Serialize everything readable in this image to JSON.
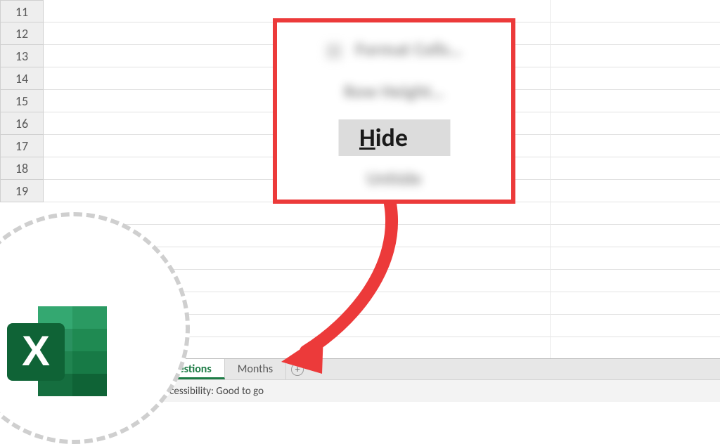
{
  "row_headers": [
    "11",
    "12",
    "13",
    "14",
    "15",
    "16",
    "17",
    "18",
    "19"
  ],
  "context_menu": {
    "item_format": "Format Cells…",
    "item_row_height": "Row Height…",
    "item_hide_pre": "H",
    "item_hide_post": "ide",
    "item_unhide": "Unhide"
  },
  "tabs": {
    "active": "Questions",
    "second": "Months"
  },
  "status": {
    "accessibility": "Accessibility: Good to go"
  }
}
